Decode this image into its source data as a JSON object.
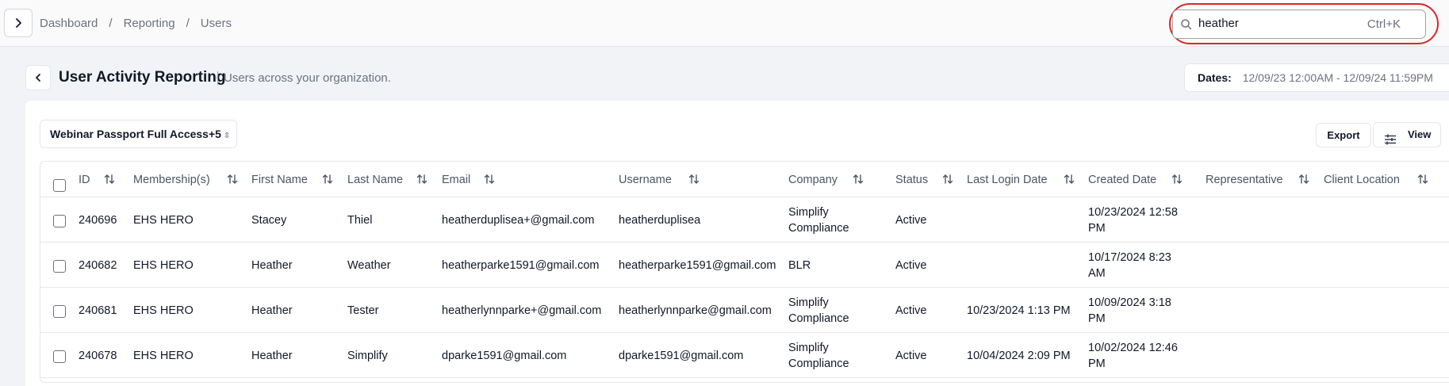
{
  "breadcrumb": {
    "items": [
      "Dashboard",
      "Reporting",
      "Users"
    ],
    "sep": "/"
  },
  "search": {
    "value": "heather",
    "shortcut": "Ctrl+K"
  },
  "page": {
    "title": "User Activity Reporting",
    "subtitle": "Users across your organization."
  },
  "dates": {
    "label": "Dates:",
    "value": "12/09/23 12:00AM - 12/09/24 11:59PM"
  },
  "toolbar": {
    "membership": "Webinar Passport Full Access+5",
    "export_label": "Export",
    "view_label": "View"
  },
  "table": {
    "headers": [
      "ID",
      "Membership(s)",
      "First Name",
      "Last Name",
      "Email",
      "Username",
      "Company",
      "Status",
      "Last Login Date",
      "Created Date",
      "Representative",
      "Client Location"
    ],
    "rows": [
      {
        "id": "240696",
        "membership": "EHS HERO",
        "first": "Stacey",
        "last": "Thiel",
        "email": "heatherduplisea+@gmail.com",
        "username": "heatherduplisea",
        "company": "Simplify Compliance",
        "status": "Active",
        "last_login": "",
        "created": "10/23/2024 12:58 PM",
        "rep": "",
        "location": ""
      },
      {
        "id": "240682",
        "membership": "EHS HERO",
        "first": "Heather",
        "last": "Weather",
        "email": "heatherparke1591@gmail.com",
        "username": "heatherparke1591@gmail.com",
        "company": "BLR",
        "status": "Active",
        "last_login": "",
        "created": "10/17/2024 8:23 AM",
        "rep": "",
        "location": ""
      },
      {
        "id": "240681",
        "membership": "EHS HERO",
        "first": "Heather",
        "last": "Tester",
        "email": "heatherlynnparke+@gmail.com",
        "username": "heatherlynnparke@gmail.com",
        "company": "Simplify Compliance",
        "status": "Active",
        "last_login": "10/23/2024 1:13 PM",
        "created": "10/09/2024 3:18 PM",
        "rep": "",
        "location": ""
      },
      {
        "id": "240678",
        "membership": "EHS HERO",
        "first": "Heather",
        "last": "Simplify",
        "email": "dparke1591@gmail.com",
        "username": "dparke1591@gmail.com",
        "company": "Simplify Compliance",
        "status": "Active",
        "last_login": "10/04/2024 2:09 PM",
        "created": "10/02/2024 12:46 PM",
        "rep": "",
        "location": ""
      }
    ]
  }
}
